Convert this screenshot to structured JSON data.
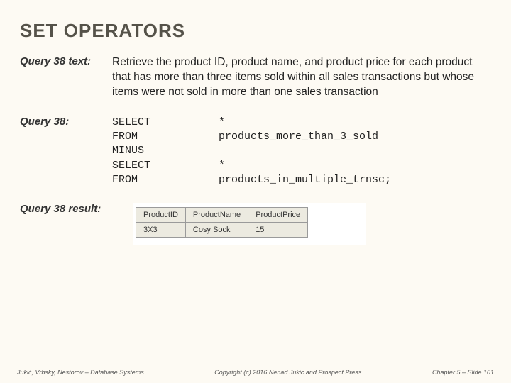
{
  "title": "SET OPERATORS",
  "q38text": {
    "label": "Query 38 text:",
    "body": "Retrieve the product ID, product name, and product price for each product that has more than three items sold within all sales transactions but whose items were not sold in more than one sales transaction"
  },
  "q38": {
    "label": "Query 38:",
    "sql": [
      {
        "kw": "SELECT",
        "arg": "*"
      },
      {
        "kw": "FROM",
        "arg": "products_more_than_3_sold"
      },
      {
        "kw": "MINUS",
        "arg": ""
      },
      {
        "kw": "SELECT",
        "arg": "*"
      },
      {
        "kw": "FROM",
        "arg": "products_in_multiple_trnsc;"
      }
    ]
  },
  "result": {
    "label": "Query 38 result:",
    "headers": [
      "ProductID",
      "ProductName",
      "ProductPrice"
    ],
    "rows": [
      [
        "3X3",
        "Cosy Sock",
        "15"
      ]
    ]
  },
  "footer": {
    "left": "Jukić, Vrbsky, Nestorov – Database Systems",
    "center": "Copyright (c) 2016 Nenad Jukic and Prospect Press",
    "right": "Chapter 5 – Slide 101"
  }
}
